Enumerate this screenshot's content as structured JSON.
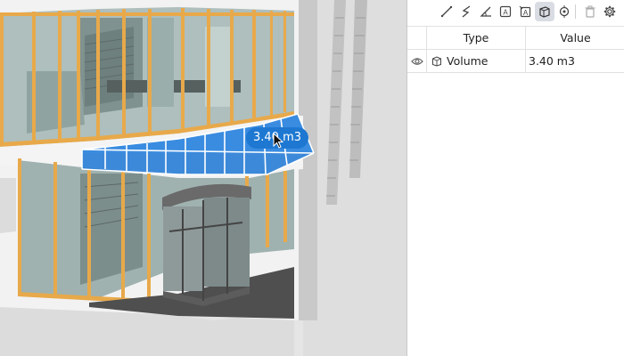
{
  "viewport": {
    "measurement_label": "3.40 m3"
  },
  "toolbar": {
    "tools": [
      {
        "name": "distance-tool-icon",
        "active": false
      },
      {
        "name": "polyline-tool-icon",
        "active": false
      },
      {
        "name": "angle-tool-icon",
        "active": false
      },
      {
        "name": "area-tool-icon",
        "active": false
      },
      {
        "name": "height-tool-icon",
        "active": false
      },
      {
        "name": "volume-tool-icon",
        "active": true
      },
      {
        "name": "point-tool-icon",
        "active": false
      },
      {
        "name": "trash-icon",
        "active": false
      },
      {
        "name": "gear-icon",
        "active": false
      }
    ]
  },
  "table": {
    "headers": {
      "type": "Type",
      "value": "Value"
    },
    "rows": [
      {
        "type": "Volume",
        "value": "3.40 m3",
        "visible": true,
        "icon": "volume-cube-icon"
      }
    ]
  },
  "colors": {
    "accent": "#1e78d2",
    "window_frame": "#e8a94a",
    "glass": "#a9bdbc"
  }
}
